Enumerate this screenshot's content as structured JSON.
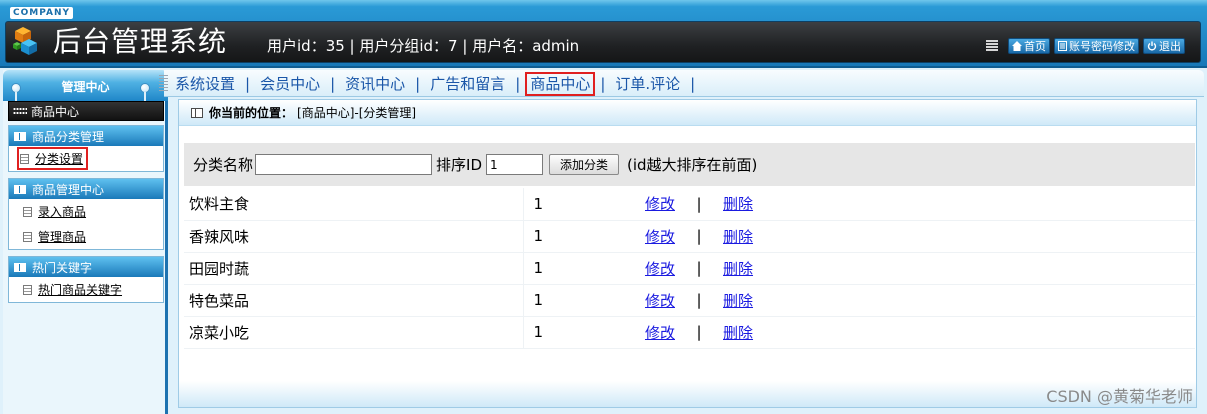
{
  "header": {
    "company": "COMPANY",
    "title": "后台管理系统",
    "user_info": "用户id：35 | 用户分组id：7 | 用户名：admin",
    "links": {
      "home": "首页",
      "password": "账号密码修改",
      "logout": "退出"
    }
  },
  "sidebar": {
    "title": "管理中心",
    "current_module": "商品中心",
    "groups": [
      {
        "title": "商品分类管理",
        "items": [
          "分类设置"
        ]
      },
      {
        "title": "商品管理中心",
        "items": [
          "录入商品",
          "管理商品"
        ]
      },
      {
        "title": "热门关键字",
        "items": [
          "热门商品关键字"
        ]
      }
    ]
  },
  "nav": {
    "tabs": [
      "系统设置",
      "会员中心",
      "资讯中心",
      "广告和留言",
      "商品中心",
      "订单.评论"
    ],
    "separator": "|",
    "active_tab": "商品中心"
  },
  "breadcrumb": {
    "label": "你当前的位置：",
    "path": "[商品中心]-[分类管理]"
  },
  "form": {
    "name_label": "分类名称",
    "name_value": "",
    "order_label": "排序ID",
    "order_value": "1",
    "add_button": "添加分类",
    "hint": "(id越大排序在前面)"
  },
  "table": {
    "edit_label": "修改",
    "delete_label": "删除",
    "separator": "|",
    "rows": [
      {
        "name": "饮料主食",
        "order": "1"
      },
      {
        "name": "香辣风味",
        "order": "1"
      },
      {
        "name": "田园时蔬",
        "order": "1"
      },
      {
        "name": "特色菜品",
        "order": "1"
      },
      {
        "name": "凉菜小吃",
        "order": "1"
      }
    ]
  },
  "watermark": "CSDN @黄菊华老师",
  "colors": {
    "header_blue": "#1878b8",
    "nav_link": "#1a56a8",
    "table_link": "#1a1ae0",
    "highlight_red": "#e02020"
  }
}
